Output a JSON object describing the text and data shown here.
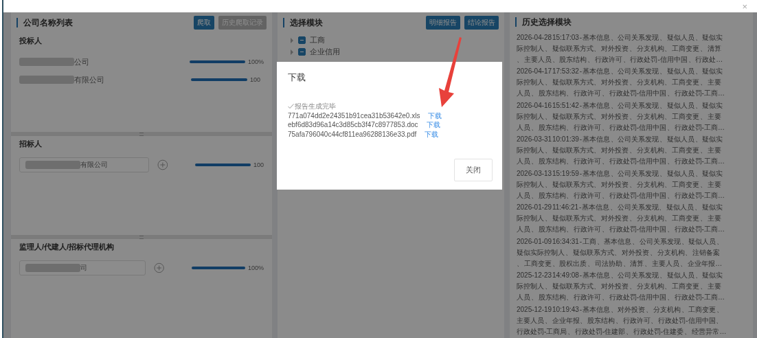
{
  "top_bar": {
    "close": "×"
  },
  "company_panel": {
    "title": "公司名称列表",
    "buttons": [
      {
        "label": "爬取",
        "kind": "primary"
      },
      {
        "label": "历史爬取记录",
        "kind": "secondary"
      }
    ],
    "sections": [
      {
        "title": "投标人",
        "rows": [
          {
            "kind": "text",
            "name": "公司",
            "level": 1,
            "reading": "100%"
          },
          {
            "kind": "text",
            "name": "有限公司",
            "level": 1,
            "reading": "100"
          }
        ]
      },
      {
        "title": "招标人",
        "rows": [
          {
            "kind": "input",
            "name": "有限公司",
            "level": 1,
            "reading": "100"
          }
        ]
      },
      {
        "title": "监理人/代建人/招标代理机构",
        "rows": [
          {
            "kind": "input",
            "name": "司",
            "level": 1,
            "reading": "100%"
          }
        ]
      }
    ]
  },
  "module_panel": {
    "title": "选择模块",
    "buttons": [
      {
        "label": "明细报告",
        "kind": "primary"
      },
      {
        "label": "结论报告",
        "kind": "primary"
      }
    ],
    "tree": [
      {
        "label": "工商",
        "indeterminate": true,
        "expanded": false
      },
      {
        "label": "企业信用",
        "indeterminate": true,
        "expanded": false
      }
    ]
  },
  "history_panel": {
    "title": "历史选择模块",
    "entries": [
      {
        "lines": [
          "2026-04-28 15:17:03 - 基本信息 、 公司关系发现 、 疑似人员 、 疑似实",
          "际控制人 、 疑似联系方式 、 对外投资 、 分支机构 、 工商变更 、 清算",
          "、 主要人员 、 股东结构 、 行政许可 、 行政处罚-信用中国 、 行政处…"
        ]
      },
      {
        "lines": [
          "2026-04-17 17:53:32 - 基本信息 、 公司关系发现 、 疑似人员 、 疑似实",
          "际控制人 、 疑似联系方式 、 对外投资 、 分支机构 、 工商变更 、 主要",
          "人员 、 股东结构 、 行政许可 、 行政处罚-信用中国 、 行政处罚-工商…"
        ]
      },
      {
        "lines": [
          "2026-04-16 15:51:42 - 基本信息 、 公司关系发现 、 疑似人员 、 疑似实",
          "际控制人 、 疑似联系方式 、 对外投资 、 分支机构 、 工商变更 、 主要",
          "人员 、 股东结构 、 行政许可 、 行政处罚-信用中国 、 行政处罚-工商…"
        ]
      },
      {
        "lines": [
          "2026-03-31 10:01:39 - 基本信息 、 公司关系发现 、 疑似人员 、 疑似实",
          "际控制人 、 疑似联系方式 、 对外投资 、 分支机构 、 工商变更 、 主要",
          "人员 、 股东结构 、 行政许可 、 行政处罚-信用中国 、 行政处罚-工商…"
        ]
      },
      {
        "lines": [
          "2026-03-13 15:19:59 - 基本信息 、 公司关系发现 、 疑似人员 、 疑似实",
          "际控制人 、 疑似联系方式 、 对外投资 、 分支机构 、 工商变更 、 主要",
          "人员 、 股东结构 、 行政许可 、 行政处罚-信用中国 、 行政处罚-工商…"
        ]
      },
      {
        "lines": [
          "2026-01-29 11:46:21 - 基本信息 、 公司关系发现 、 疑似人员 、 疑似实",
          "际控制人 、 疑似联系方式 、 对外投资 、 分支机构 、 工商变更 、 主要",
          "人员 、 股东结构 、 行政许可 、 行政处罚-信用中国 、 行政处罚-工商…"
        ]
      },
      {
        "lines": [
          "2026-01-09 16:34:31 - 工商 、 基本信息 、 公司关系发现 、 疑似人员 、",
          "疑似实际控制人 、 疑似联系方式 、 对外投资 、 分支机构 、 注销备案",
          "、 工商变更 、 股权出质 、 司法协助 、 清算 、 主要人员 、 企业年报 …"
        ]
      },
      {
        "lines": [
          "2025-12-23 14:49:08 - 基本信息 、 公司关系发现 、 疑似人员 、 疑似实",
          "际控制人 、 疑似联系方式 、 对外投资 、 分支机构 、 工商变更 、 主要",
          "人员 、 股东结构 、 行政许可 、 行政处罚-信用中国 、 行政处罚-工商…"
        ]
      },
      {
        "lines": [
          "2025-12-19 10:19:43 - 基本信息 、 对外投资 、 分支机构 、 工商变更 、",
          "主要人员 、 企业年报 、 股东结构 、 行政许可 、 行政处罚-信用中国 、",
          "行政处罚-工商局 、 行政处罚-住建部 、 行政处罚-住建委 、 经营异常 …"
        ]
      }
    ]
  },
  "dialog": {
    "title": "下载",
    "status": "报告生成完毕",
    "files": [
      {
        "name": "771a074dd2e24351b91cea31b53642e0.xls",
        "link": "下载"
      },
      {
        "name": "ebf6d83d96a14c3d85cb3f47c8977853.doc",
        "link": "下载"
      },
      {
        "name": "75afa796040c44cf811ea96288136e33.pdf",
        "link": "下载"
      }
    ],
    "button": "关闭"
  }
}
